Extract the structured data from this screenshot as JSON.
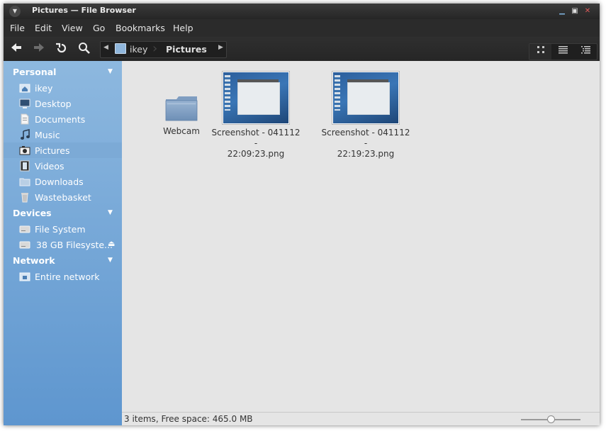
{
  "window": {
    "title": "Pictures — File Browser",
    "controls": [
      "minimize-icon",
      "maximize-icon",
      "close-icon"
    ]
  },
  "menubar": {
    "items": [
      "File",
      "Edit",
      "View",
      "Go",
      "Bookmarks",
      "Help"
    ]
  },
  "toolbar": {
    "buttons": [
      "back-icon",
      "forward-icon",
      "reload-icon",
      "search-icon"
    ],
    "forward_disabled": true,
    "path": {
      "home": "ikey",
      "current": "Pictures"
    },
    "views": [
      "icon-view-icon",
      "compact-view-icon",
      "list-view-icon"
    ],
    "active_view": "icon-view-icon"
  },
  "sidebar": {
    "sections": [
      {
        "title": "Personal",
        "items": [
          {
            "label": "ikey",
            "icon": "home-icon"
          },
          {
            "label": "Desktop",
            "icon": "desktop-icon"
          },
          {
            "label": "Documents",
            "icon": "documents-icon"
          },
          {
            "label": "Music",
            "icon": "music-icon"
          },
          {
            "label": "Pictures",
            "icon": "pictures-icon",
            "selected": true
          },
          {
            "label": "Videos",
            "icon": "videos-icon"
          },
          {
            "label": "Downloads",
            "icon": "downloads-icon"
          },
          {
            "label": "Wastebasket",
            "icon": "trash-icon"
          }
        ]
      },
      {
        "title": "Devices",
        "items": [
          {
            "label": "File System",
            "icon": "drive-icon"
          },
          {
            "label": "38 GB Filesyste...",
            "icon": "drive-icon",
            "eject": true
          }
        ]
      },
      {
        "title": "Network",
        "items": [
          {
            "label": "Entire network",
            "icon": "network-icon"
          }
        ]
      }
    ]
  },
  "files": [
    {
      "name": "Webcam",
      "type": "folder"
    },
    {
      "name": "Screenshot - 041112 -\n22:09:23.png",
      "type": "image"
    },
    {
      "name": "Screenshot - 041112 -\n22:19:23.png",
      "type": "image"
    }
  ],
  "statusbar": {
    "text": "3 items, Free space: 465.0 MB",
    "zoom_fraction": 0.5
  },
  "colors": {
    "sidebar_top": "#8db8df",
    "sidebar_bottom": "#5e96cf",
    "content_bg": "#e5e5e5",
    "titlebar": "#2b2b2b"
  }
}
